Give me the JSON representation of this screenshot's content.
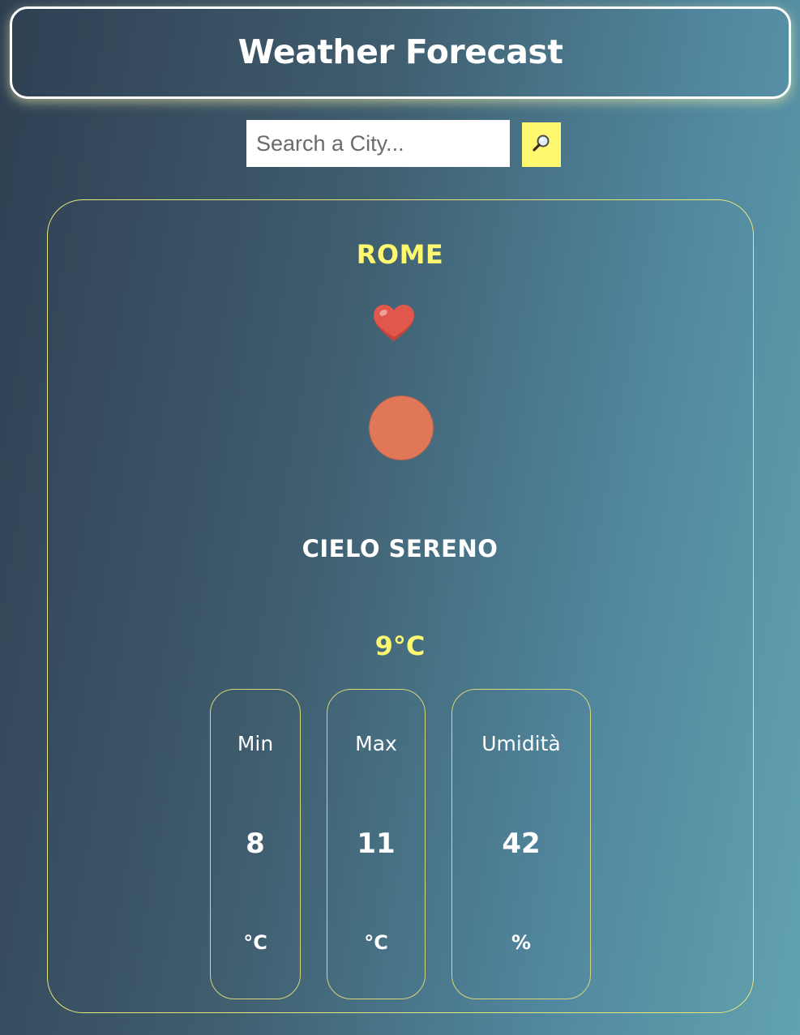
{
  "header": {
    "title": "Weather Forecast"
  },
  "search": {
    "placeholder": "Search a City...",
    "value": "",
    "button_icon": "magnifying-glass-icon"
  },
  "weather": {
    "city": "ROME",
    "favorite_icon": "heart-icon",
    "condition_icon": "sun-icon",
    "description": "CIELO SERENO",
    "temperature": "9°C",
    "stats": [
      {
        "label": "Min",
        "value": "8",
        "unit": "°C"
      },
      {
        "label": "Max",
        "value": "11",
        "unit": "°C"
      },
      {
        "label": "Umidità",
        "value": "42",
        "unit": "%"
      }
    ]
  },
  "colors": {
    "accent_yellow": "#fdf870",
    "heart_red": "#e2574c",
    "sun_orange": "#e07759",
    "background_start": "#2f3f52",
    "background_end": "#62a2ae"
  }
}
